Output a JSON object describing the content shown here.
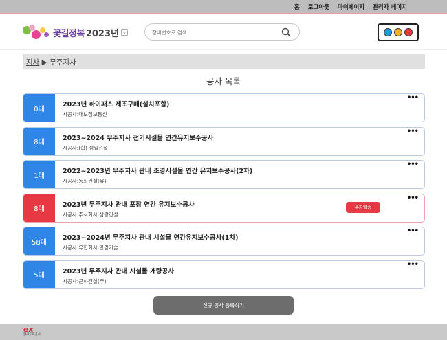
{
  "topnav": [
    "홈",
    "로그아웃",
    "마이페이지",
    "관리자 페이지"
  ],
  "logo": {
    "text": "꽃길정복",
    "year": "2023년",
    "dropdown_icon": "chevron-down-icon"
  },
  "search": {
    "placeholder": "장비번호로 검색",
    "icon": "search-icon"
  },
  "traffic_light": {
    "colors": [
      "#1f9bd6",
      "#f0b323",
      "#e53a44"
    ]
  },
  "breadcrumb": {
    "parent": "지사",
    "separator": "▶",
    "current": "무주지사"
  },
  "page_title": "공사 목록",
  "projects": [
    {
      "count": "0대",
      "title": "2023년 하이패스 제조구매(설치포함)",
      "contractor": "시공사:대보정보통신",
      "color": "#2f86e6",
      "alert": false
    },
    {
      "count": "8대",
      "title": "2023~2024 무주지사 전기시설물 연간유지보수공사",
      "contractor": "시공사:(합) 성일전설",
      "color": "#2f86e6",
      "alert": false
    },
    {
      "count": "1대",
      "title": "2022~2023년 무주지사 관내 조경시설물 연간 유지보수공사(2차)",
      "contractor": "시공사:동화건설(유)",
      "color": "#2f86e6",
      "alert": false
    },
    {
      "count": "8대",
      "title": "2023년 무주지사 관내 포장 연간 유지보수공사",
      "contractor": "시공사:주식회사 삼광건설",
      "color": "#e53a44",
      "alert": true,
      "sms_label": "문자발송"
    },
    {
      "count": "58대",
      "title": "2023~2024년 무주지사 관내 시설물 연간유지보수공사(1차)",
      "contractor": "시공사:유한회사 만경기술",
      "color": "#2f86e6",
      "alert": false
    },
    {
      "count": "5대",
      "title": "2023년 무주지사 관내 시설물 개량공사",
      "contractor": "시공사:근하건설(주)",
      "color": "#2f86e6",
      "alert": false
    }
  ],
  "more_label": "•••",
  "new_button": "신규 공사 등록하기",
  "footer": {
    "logo_mark": "ex",
    "logo_name": "한국도로공사"
  }
}
